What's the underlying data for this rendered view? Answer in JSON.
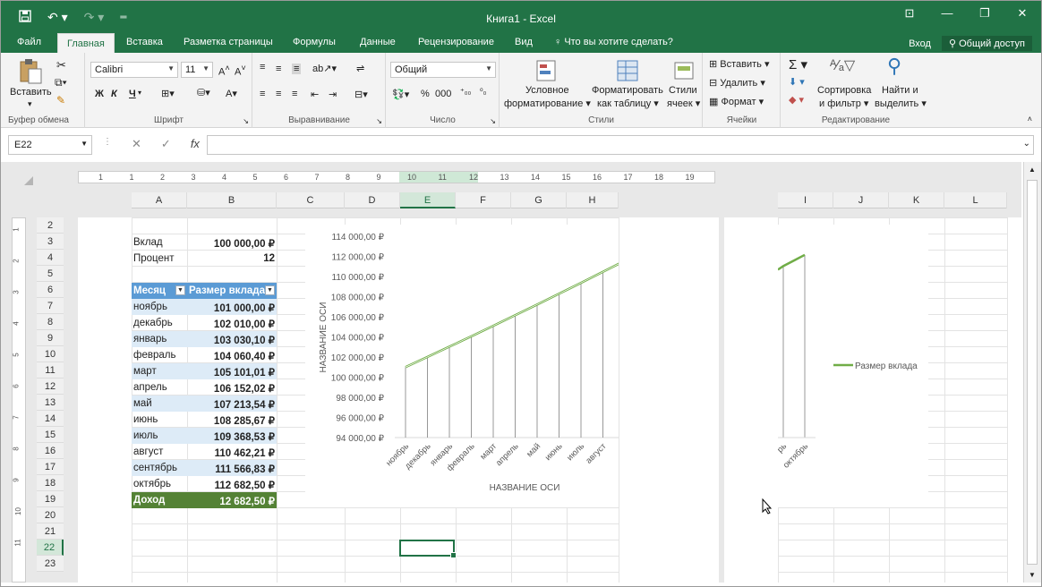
{
  "window": {
    "title": "Книга1 - Excel"
  },
  "tabs": [
    "Файл",
    "Главная",
    "Вставка",
    "Разметка страницы",
    "Формулы",
    "Данные",
    "Рецензирование",
    "Вид"
  ],
  "tell_me": "Что вы хотите сделать?",
  "login": "Вход",
  "share": "Общий доступ",
  "ribbon": {
    "clipboard": {
      "paste": "Вставить",
      "label": "Буфер обмена"
    },
    "font": {
      "name": "Calibri",
      "size": "11",
      "bold": "Ж",
      "italic": "К",
      "underline": "Ч",
      "label": "Шрифт"
    },
    "alignment": {
      "label": "Выравнивание"
    },
    "number": {
      "format": "Общий",
      "label": "Число"
    },
    "styles": {
      "conditional1": "Условное",
      "conditional2": "форматирование",
      "format_table1": "Форматировать",
      "format_table2": "как таблицу",
      "cell_styles1": "Стили",
      "cell_styles2": "ячеек",
      "label": "Стили"
    },
    "cells": {
      "insert": "Вставить",
      "delete": "Удалить",
      "format": "Формат",
      "label": "Ячейки"
    },
    "editing": {
      "sort1": "Сортировка",
      "sort2": "и фильтр",
      "find1": "Найти и",
      "find2": "выделить",
      "label": "Редактирование"
    }
  },
  "formula_bar": {
    "name_box": "E22",
    "formula": ""
  },
  "ruler": [
    "1",
    "1",
    "2",
    "3",
    "4",
    "5",
    "6",
    "7",
    "8",
    "9",
    "10",
    "11",
    "12",
    "13",
    "14",
    "15",
    "16",
    "17",
    "18",
    "19"
  ],
  "vruler": [
    "1",
    "2",
    "3",
    "4",
    "5",
    "6",
    "7",
    "8",
    "9",
    "10",
    "11"
  ],
  "columns": [
    "A",
    "B",
    "C",
    "D",
    "E",
    "F",
    "G",
    "H",
    "I",
    "J",
    "K",
    "L"
  ],
  "rows": [
    "2",
    "3",
    "4",
    "5",
    "6",
    "7",
    "8",
    "9",
    "10",
    "11",
    "12",
    "13",
    "14",
    "15",
    "16",
    "17",
    "18",
    "19",
    "20",
    "21",
    "22",
    "23"
  ],
  "selected_column": "E",
  "selected_row": "22",
  "sheet": {
    "deposit_label": "Вклад",
    "deposit_value": "100 000,00 ₽",
    "percent_label": "Процент",
    "percent_value": "12",
    "table_header": [
      "Месяц",
      "Размер вклада"
    ],
    "table_rows": [
      [
        "ноябрь",
        "101 000,00 ₽"
      ],
      [
        "декабрь",
        "102 010,00 ₽"
      ],
      [
        "январь",
        "103 030,10 ₽"
      ],
      [
        "февраль",
        "104 060,40 ₽"
      ],
      [
        "март",
        "105 101,01 ₽"
      ],
      [
        "апрель",
        "106 152,02 ₽"
      ],
      [
        "май",
        "107 213,54 ₽"
      ],
      [
        "июнь",
        "108 285,67 ₽"
      ],
      [
        "июль",
        "109 368,53 ₽"
      ],
      [
        "август",
        "110 462,21 ₽"
      ],
      [
        "сентябрь",
        "111 566,83 ₽"
      ],
      [
        "октябрь",
        "112 682,50 ₽"
      ]
    ],
    "income_label": "Доход",
    "income_value": "12 682,50 ₽"
  },
  "chart_data": {
    "type": "line",
    "title": "",
    "xlabel": "НАЗВАНИЕ ОСИ",
    "ylabel": "НАЗВАНИЕ ОСИ",
    "categories": [
      "ноябрь",
      "декабрь",
      "январь",
      "февраль",
      "март",
      "апрель",
      "май",
      "июнь",
      "июль",
      "август",
      "сентябрь",
      "октябрь"
    ],
    "ylim": [
      94000,
      114000
    ],
    "yticks": [
      "94 000,00 ₽",
      "96 000,00 ₽",
      "98 000,00 ₽",
      "100 000,00 ₽",
      "102 000,00 ₽",
      "104 000,00 ₽",
      "106 000,00 ₽",
      "108 000,00 ₽",
      "110 000,00 ₽",
      "112 000,00 ₽",
      "114 000,00 ₽"
    ],
    "series": [
      {
        "name": "Размер вклада",
        "values": [
          101000,
          102010,
          103030.1,
          104060.4,
          105101.01,
          106152.02,
          107213.54,
          108285.67,
          109368.53,
          110462.21,
          111566.83,
          112682.5
        ],
        "color": "#70ad47"
      }
    ],
    "drop_lines": true,
    "legend": "right"
  },
  "colors": {
    "accent": "#217346",
    "table_header": "#5b9bd5",
    "band": "#ddebf7",
    "income": "#548235",
    "series": "#70ad47"
  }
}
